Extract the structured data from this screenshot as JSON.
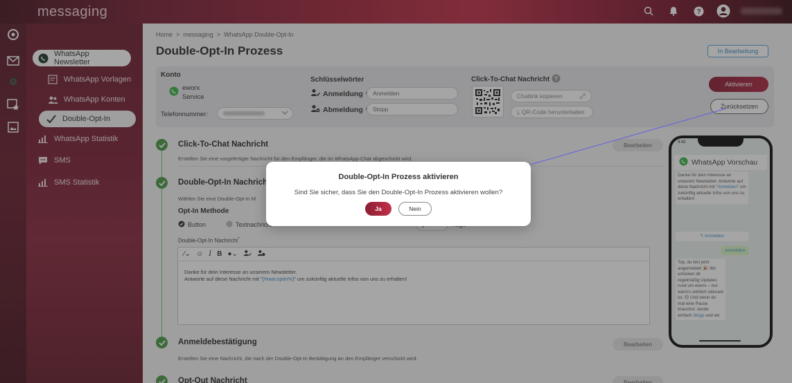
{
  "app": {
    "title": "messaging"
  },
  "sidebar": {
    "items": [
      {
        "label": "WhatsApp Newsletter",
        "icon": "whatsapp-icon"
      },
      {
        "label": "WhatsApp Vorlagen",
        "icon": "template-icon"
      },
      {
        "label": "WhatsApp Konten",
        "icon": "users-icon"
      },
      {
        "label": "Double-Opt-In",
        "icon": "check-icon"
      },
      {
        "label": "WhatsApp Statistik",
        "icon": "bar-chart-icon"
      },
      {
        "label": "SMS",
        "icon": "sms-icon"
      },
      {
        "label": "SMS Statistik",
        "icon": "bar-chart-icon"
      }
    ]
  },
  "breadcrumb": {
    "home": "Home",
    "sep": ">",
    "section": "messaging",
    "current": "WhatsApp Double-Opt-In"
  },
  "page": {
    "title": "Double-Opt-In Prozess",
    "status": "In Bearbeitung"
  },
  "config": {
    "konto_label": "Konto",
    "account_name_1": "eworx",
    "account_name_2": "Service",
    "phone_label": "Telefonnummer:",
    "keywords_label": "Schlüsselwörter",
    "subscribe_label": "Anmeldung",
    "subscribe_value": "Anmelden",
    "unsubscribe_label": "Abmeldung",
    "unsubscribe_value": "Stopp",
    "required_mark": "*",
    "ctc_label": "Click-To-Chat Nachricht",
    "copy_link": "Chatlink kopieren",
    "download_qr": "QR-Code herunterladen",
    "download_arrow": "⤓"
  },
  "actions": {
    "activate": "Aktivieren",
    "reset": "Zurücksetzen"
  },
  "steps": {
    "s1_title": "Click-To-Chat Nachricht",
    "s1_desc": "Erstellen Sie eine vorgefertigte Nachricht für den Empfänger, die im WhatsApp-Chat abgeschickt wird.",
    "s2_title": "Double-Opt-In Nachricht",
    "s2_desc": "Wählen Sie eine Double-Opt-In M",
    "optin_method": "Opt-In Methode",
    "radio_button": "Button",
    "radio_text": "Textnachricht",
    "days_value": "1",
    "days_label": "Tage",
    "msg_label": "Double-Opt-In Nachricht",
    "s3_title": "Anmeldebestätigung",
    "s3_desc": "Erstellen Sie eine Nachricht, die nach der Double-Opt-In Bestätigung an den Empfänger verschickt wird.",
    "s4_title": "Opt-Out Nachricht",
    "edit": "Bearbeiten"
  },
  "editor": {
    "line1": "Danke für dein Interesse an unserem Newsletter.",
    "line2a": "Antworte auf diese Nachricht mit \"",
    "line2var": "[%wa:optin%]",
    "line2b": "\" um zukünftig aktuelle Infos von uns zu erhalten!"
  },
  "preview": {
    "time": "4:42",
    "title": "WhatsApp Vorschau",
    "msg1a": "Danke für dein Interesse an unserem Newsletter. Antworte auf diese Nachricht mit \"",
    "msg1var": "Anmelden",
    "msg1b": "\" um zukünftig aktuelle Infos von uns zu erhalten!",
    "reply_button": "Anmelden",
    "reply_bubble": "Anmelden",
    "msg2a": "Top, du bist jetzt angemeldet! 🎉 Wir schicken dir regelmäßig Updates rund um eworx – nur wenn's wirklich relevant ist. 😊 Und wenn du mal eine Pause brauchst: sende einfach ",
    "msg2var": "Stopp",
    "msg2b": " und wir"
  },
  "dialog": {
    "title": "Double-Opt-In Prozess aktivieren",
    "message": "Sind Sie sicher, dass Sie den Double-Opt-In Prozess aktivieren wollen?",
    "yes": "Ja",
    "no": "Nein"
  },
  "colors": {
    "brand": "#a8283e",
    "success": "#4c9a46",
    "link": "#3a8fc6"
  }
}
